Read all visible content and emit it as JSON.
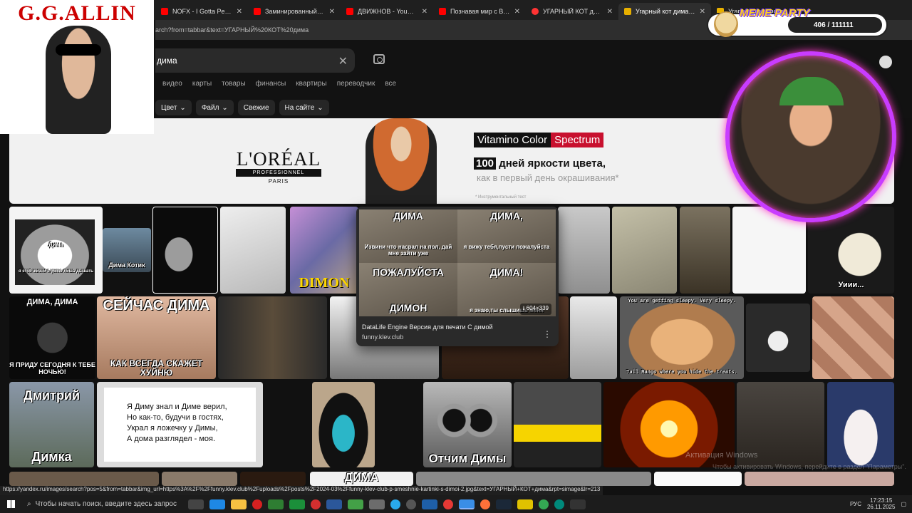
{
  "tabs": [
    {
      "title": "NOFX - I Gotta Pee - Yo",
      "icon": "youtube-icon"
    },
    {
      "title": "Заминированный тапс",
      "icon": "youtube-icon"
    },
    {
      "title": "ДВИЖНОВ - YouTube",
      "icon": "youtube-icon"
    },
    {
      "title": "Познавая мир с Викто",
      "icon": "youtube-icon"
    },
    {
      "title": "УГАРНЫЙ КОТ дима -",
      "icon": "yandex-icon"
    },
    {
      "title": "Угарный кот дима: см",
      "icon": "images-icon",
      "active": true
    },
    {
      "title": "Угарный кот смотре",
      "icon": "images-icon"
    }
  ],
  "address": "arch?from=tabbar&text=УГАРНЫЙ%20КОТ%20дима",
  "search": {
    "value": "дима"
  },
  "nav": [
    "видео",
    "карты",
    "товары",
    "финансы",
    "квартиры",
    "переводчик",
    "все"
  ],
  "filters": [
    "Цвет",
    "Файл",
    "Свежие",
    "На сайте"
  ],
  "ad": {
    "brand": "L'ORÉAL",
    "brand_line2": "PROFESSIONNEL",
    "brand_line3": "PARIS",
    "product_a": "Vitamino Color",
    "product_b": "Spectrum",
    "days_num": "100",
    "days_text": "дней яркости цвета,",
    "days_sub": "как в первый день окрашивания*",
    "fine": "* Инструментальный тест"
  },
  "thumbs": {
    "t1_cap": "Дима",
    "t1_sub": "я этой жизни я умею лишь дышать",
    "t2_cap": "Дима Котик",
    "t4_cap": "DIMON",
    "t12_cap": "Уиии...",
    "r2a_top": "ДИМА, ДИМА",
    "r2a_bot": "Я ПРИДУ СЕГОДНЯ К ТЕБЕ НОЧЬЮ!",
    "r2b_top": "СЕЙЧАС ДИМА",
    "r2b_bot": "КАК ВСЕГДА СКАЖЕТ ХУЙНЮ",
    "r2h_cap": "Tail Mango where you hide the treats.",
    "r2h_top": "You are getting sleepy. Very sleepy.",
    "r3a_top": "Дмитрий",
    "r3a_bot": "Димка",
    "poem": [
      "Я Диму знал и Диме верил,",
      "Но как-то, будучи в гостях,",
      "Украл я ложечку у Димы,",
      "А дома разглядел - моя."
    ],
    "r3d_cap": "Отчим Димы",
    "r4_cap": "ДИМА"
  },
  "card": {
    "cells": [
      {
        "cap": "ДИМА",
        "sub": "Извини что насрал на пол, дай мне зайти уже"
      },
      {
        "cap": "ДИМА,",
        "sub": "я вижу тебя,пусти пожалуйста"
      },
      {
        "cap": "ПОЖАЛУЙСТА",
        "sub": "ДИМОН"
      },
      {
        "cap": "ДИМА!",
        "sub": "я знаю,ты слышишь меня"
      }
    ],
    "resolution": "604×339",
    "title": "DataLife Engine Версия для печати С димой",
    "domain": "funny.klev.club"
  },
  "overlay": {
    "gg_title": "G.G.ALLIN",
    "meme_label": "MEME PARTY",
    "meme_count": "406 / 111111"
  },
  "status_url": "https://yandex.ru/images/search?pos=5&from=tabbar&img_url=https%3A%2F%2Ffunny.klev.club%2Fuploads%2Fposts%2F2024-03%2Ffunny-klev-club-p-smeshnie-kartinki-s-dimoi-2.jpg&text=УГАРНЫЙ+КОТ+дима&rpt=simage&lr=213",
  "watermark": "Активация Windows",
  "watermark2": "Чтобы активировать Windows, перейдите в раздел \"Параметры\".",
  "taskbar": {
    "search_placeholder": "Чтобы начать поиск, введите здесь запрос",
    "lang": "РУС",
    "time": "17:23:15",
    "date": "26.11.2025"
  },
  "colors": {
    "accent": "#c93cff",
    "meme_yellow": "#ffd21f",
    "brand_red": "#c8102e"
  }
}
